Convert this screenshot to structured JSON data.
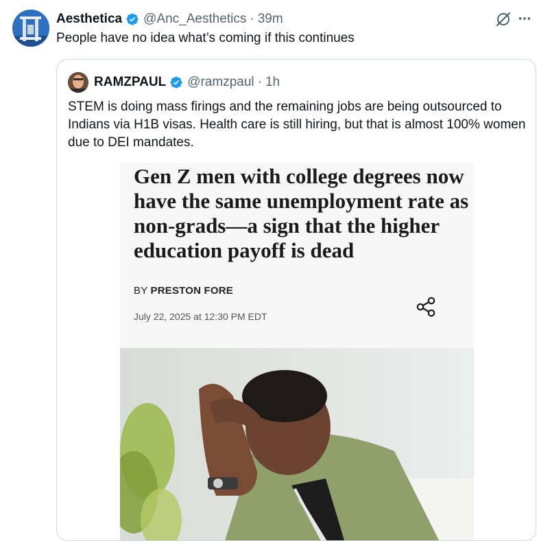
{
  "tweet": {
    "author_name": "Aesthetica",
    "handle": "@Anc_Aesthetics",
    "separator": "·",
    "time": "39m",
    "text": "People have no idea what’s coming if this continues"
  },
  "quoted_tweet": {
    "author_name": "RAMZPAUL",
    "handle": "@ramzpaul",
    "separator": "·",
    "time": "1h",
    "text": "STEM is doing mass firings and the remaining jobs are being outsourced to Indians via H1B visas. Health care is still hiring, but that is almost 100% women due to DEI mandates.",
    "article": {
      "headline": "Gen Z men with college degrees now have the same unemployment rate as non-grads—a sign that the higher education payoff is dead",
      "byline_prefix": "BY",
      "byline_author": "PRESTON FORE",
      "date": "July 22, 2025 at 12:30 PM EDT"
    }
  },
  "icons": {
    "verified": "verified-badge-icon",
    "grok": "grok-icon",
    "more": "more-options-icon",
    "share": "share-icon"
  },
  "colors": {
    "verified_blue": "#1d9bf0",
    "secondary_text": "#536471",
    "border": "#cfd9de"
  }
}
